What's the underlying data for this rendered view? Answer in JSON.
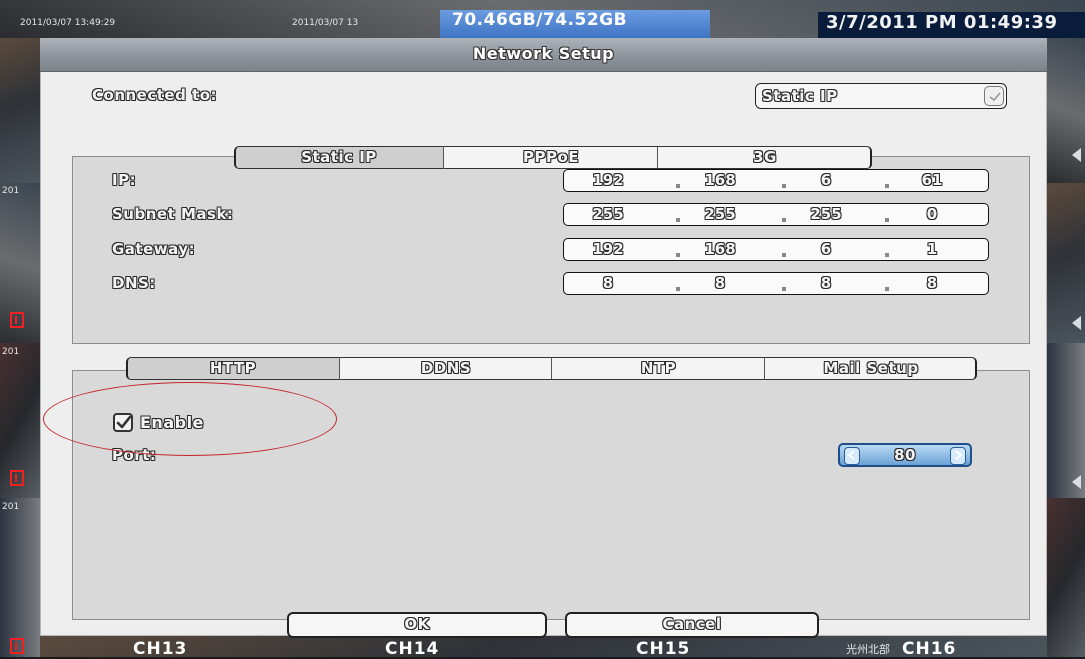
{
  "status_bar": {
    "cam_stamp_1": "2011/03/07 13:49:29",
    "cam_stamp_2": "2011/03/07 13",
    "hdd_usage": "70.46GB/74.52GB",
    "clock": "3/7/2011 PM 01:49:39"
  },
  "background": {
    "left_stamps": [
      "201",
      "201",
      "201"
    ],
    "channels": [
      "CH13",
      "CH14",
      "CH15",
      "CH16"
    ],
    "ch16_overlay": "光州北部"
  },
  "dialog": {
    "title": "Network Setup",
    "connected_to_label": "Connected to:",
    "connection_type": "Static IP",
    "connection_tabs": [
      {
        "label": "Static IP",
        "selected": true
      },
      {
        "label": "PPPoE",
        "selected": false
      },
      {
        "label": "3G",
        "selected": false
      }
    ],
    "fields": [
      {
        "label": "IP:",
        "octets": [
          "192",
          "168",
          "6",
          "61"
        ]
      },
      {
        "label": "Subnet Mask:",
        "octets": [
          "255",
          "255",
          "255",
          "0"
        ]
      },
      {
        "label": "Gateway:",
        "octets": [
          "192",
          "168",
          "6",
          "1"
        ]
      },
      {
        "label": "DNS:",
        "octets": [
          "8",
          "8",
          "8",
          "8"
        ]
      }
    ],
    "service_tabs": [
      {
        "label": "HTTP",
        "selected": true
      },
      {
        "label": "DDNS",
        "selected": false
      },
      {
        "label": "NTP",
        "selected": false
      },
      {
        "label": "Mail Setup",
        "selected": false
      }
    ],
    "http": {
      "enable_label": "Enable",
      "enabled": true,
      "port_label": "Port:",
      "port_value": "80"
    },
    "ok_label": "OK",
    "cancel_label": "Cancel"
  },
  "colors": {
    "annotation_ellipse": "#c4242a",
    "hdd_bar": "#4f86d6",
    "spinner": "#6aa2d6"
  }
}
